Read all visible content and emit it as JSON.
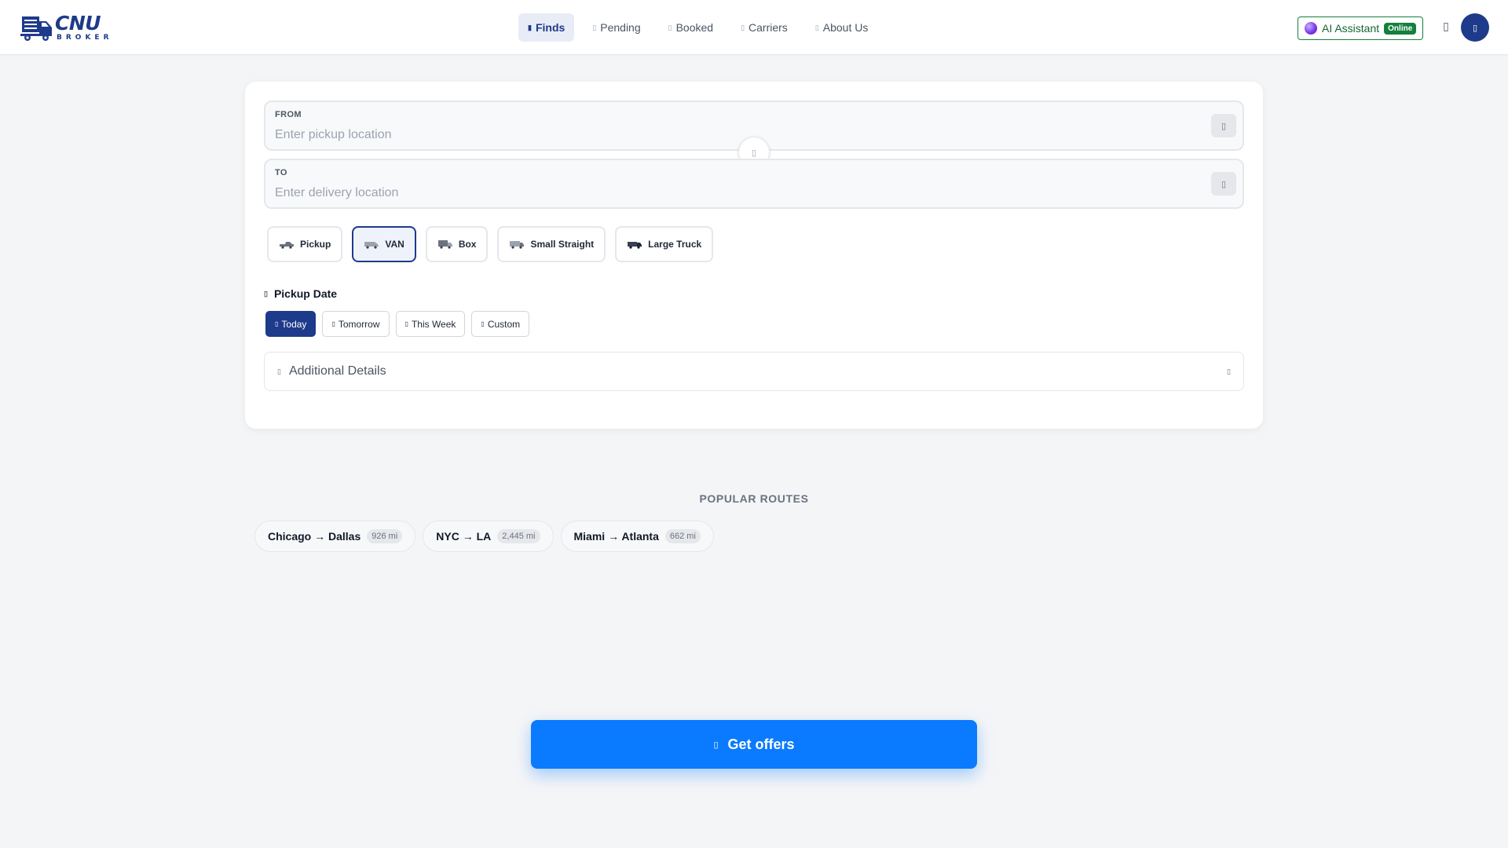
{
  "brand": {
    "name": "CNU",
    "sub": "BROKER",
    "color": "#1e3a8a"
  },
  "nav": [
    {
      "label": "Finds",
      "icon": "search-icon",
      "active": true
    },
    {
      "label": "Pending",
      "icon": "clock-icon",
      "active": false
    },
    {
      "label": "Booked",
      "icon": "check-icon",
      "active": false
    },
    {
      "label": "Carriers",
      "icon": "truck-icon",
      "active": false
    },
    {
      "label": "About Us",
      "icon": "info-icon",
      "active": false
    }
  ],
  "assistant": {
    "label": "AI Assistant",
    "status": "Online",
    "status_color": "#15803d"
  },
  "search": {
    "from_label": "FROM",
    "from_placeholder": "Enter pickup location",
    "to_label": "TO",
    "to_placeholder": "Enter delivery location"
  },
  "vehicles": [
    {
      "label": "Pickup",
      "selected": false
    },
    {
      "label": "VAN",
      "selected": true
    },
    {
      "label": "Box",
      "selected": false
    },
    {
      "label": "Small Straight",
      "selected": false
    },
    {
      "label": "Large Truck",
      "selected": false
    }
  ],
  "pickup_date": {
    "title": "Pickup Date",
    "options": [
      {
        "label": "Today",
        "active": true
      },
      {
        "label": "Tomorrow",
        "active": false
      },
      {
        "label": "This Week",
        "active": false
      },
      {
        "label": "Custom",
        "active": false
      }
    ]
  },
  "details": {
    "label": "Additional Details"
  },
  "popular_routes": {
    "title": "POPULAR ROUTES",
    "routes": [
      {
        "name": "Chicago → Dallas",
        "distance": "926 mi"
      },
      {
        "name": "NYC → LA",
        "distance": "2,445 mi"
      },
      {
        "name": "Miami → Atlanta",
        "distance": "662 mi"
      }
    ]
  },
  "cta": {
    "label": "Get offers",
    "color": "#0a7bfe"
  }
}
